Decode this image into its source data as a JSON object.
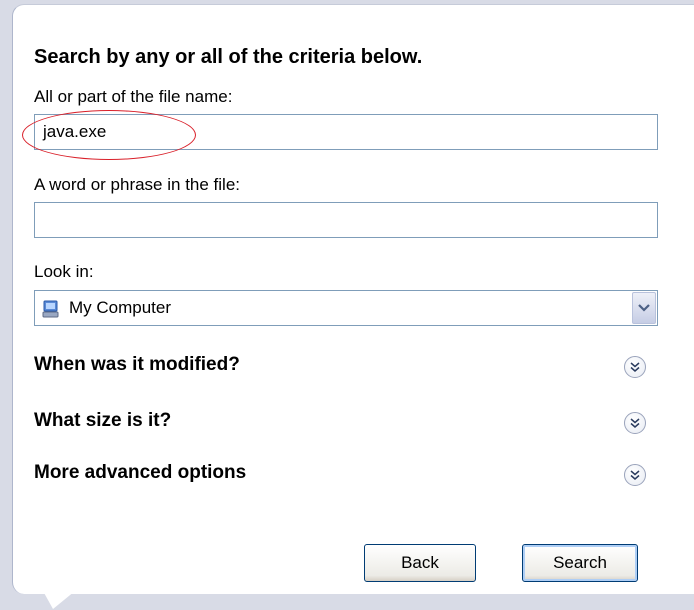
{
  "search": {
    "heading": "Search by any or all of the criteria below.",
    "filename_label": "All or part of the file name:",
    "filename_value": "java.exe",
    "phrase_label": "A word or phrase in the file:",
    "phrase_value": "",
    "lookin_label": "Look in:",
    "lookin_value": "My Computer",
    "lookin_icon": "my-computer-icon"
  },
  "sections": [
    {
      "label": "When was it modified?",
      "icon": "expand-chevron-icon"
    },
    {
      "label": "What size is it?",
      "icon": "expand-chevron-icon"
    },
    {
      "label": "More advanced options",
      "icon": "expand-chevron-icon"
    }
  ],
  "buttons": {
    "back_label": "Back",
    "search_label": "Search"
  },
  "annotation": {
    "highlight_color": "#d9202a"
  }
}
